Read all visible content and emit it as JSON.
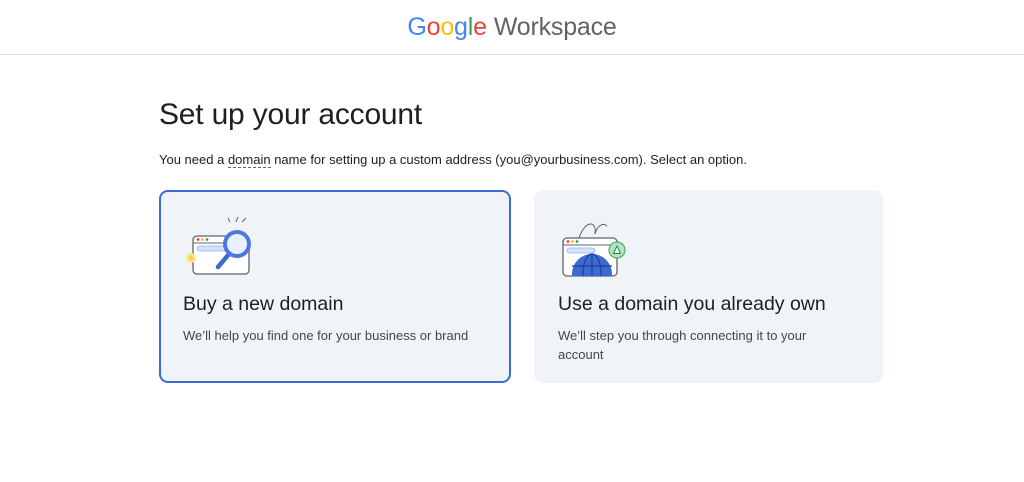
{
  "header": {
    "logo_letters": [
      "G",
      "o",
      "o",
      "g",
      "l",
      "e"
    ],
    "logo_product": "Workspace"
  },
  "main": {
    "title": "Set up your account",
    "subtitle_before": "You need a ",
    "subtitle_term": "domain",
    "subtitle_after": " name for setting up a custom address (you@yourbusiness.com). Select an option."
  },
  "options": [
    {
      "title": "Buy a new domain",
      "description": "We’ll help you find one for your business or brand",
      "selected": true,
      "icon": "search-domain-illustration"
    },
    {
      "title": "Use a domain you already own",
      "description": "We’ll step you through connecting it to your account",
      "selected": false,
      "icon": "globe-domain-illustration"
    }
  ],
  "colors": {
    "accent": "#3c6ad2",
    "card_bg": "#f0f4f9",
    "google_blue": "#4285f4",
    "google_red": "#ea4335",
    "google_yellow": "#fbbc04",
    "google_green": "#34a853"
  }
}
